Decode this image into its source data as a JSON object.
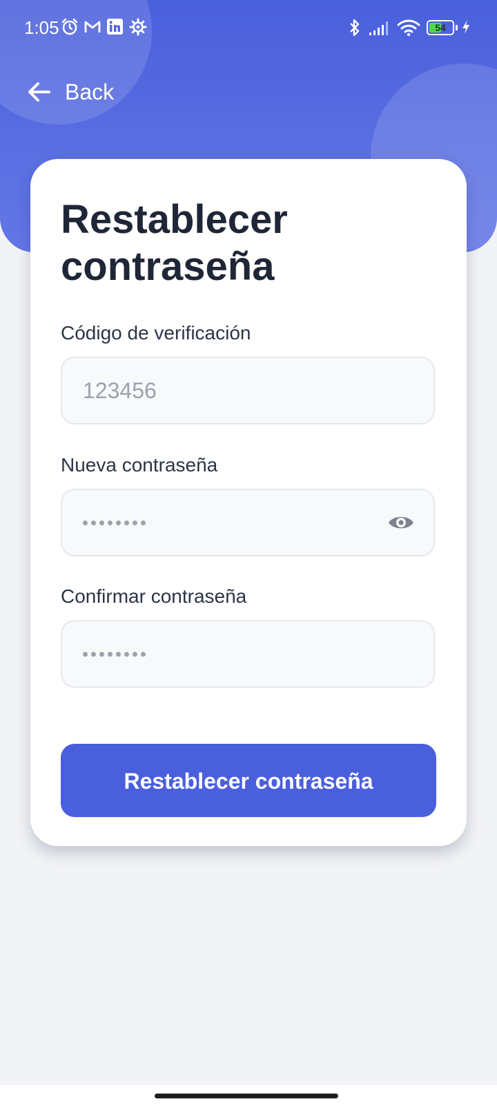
{
  "status_bar": {
    "time": "1:05",
    "battery_level": "54",
    "battery_fraction": 0.54,
    "icons": [
      "alarm-icon",
      "gmail-icon",
      "linkedin-icon",
      "settings-gear-icon",
      "bluetooth-icon",
      "signal-icon",
      "wifi-icon",
      "battery-icon",
      "charging-icon"
    ]
  },
  "header": {
    "back_label": "Back"
  },
  "card": {
    "title": "Restablecer contraseña",
    "verification_code": {
      "label": "Código de verificación",
      "placeholder": "123456"
    },
    "new_password": {
      "label": "Nueva contraseña",
      "placeholder_mask": "••••••••"
    },
    "confirm_password": {
      "label": "Confirmar contraseña",
      "placeholder_mask": "••••••••"
    },
    "submit_label": "Restablecer contraseña"
  },
  "colors": {
    "primary": "#4a5fdb",
    "title_text": "#1e2637",
    "placeholder_text": "#9ba1ad",
    "background": "#f2f3f6"
  }
}
